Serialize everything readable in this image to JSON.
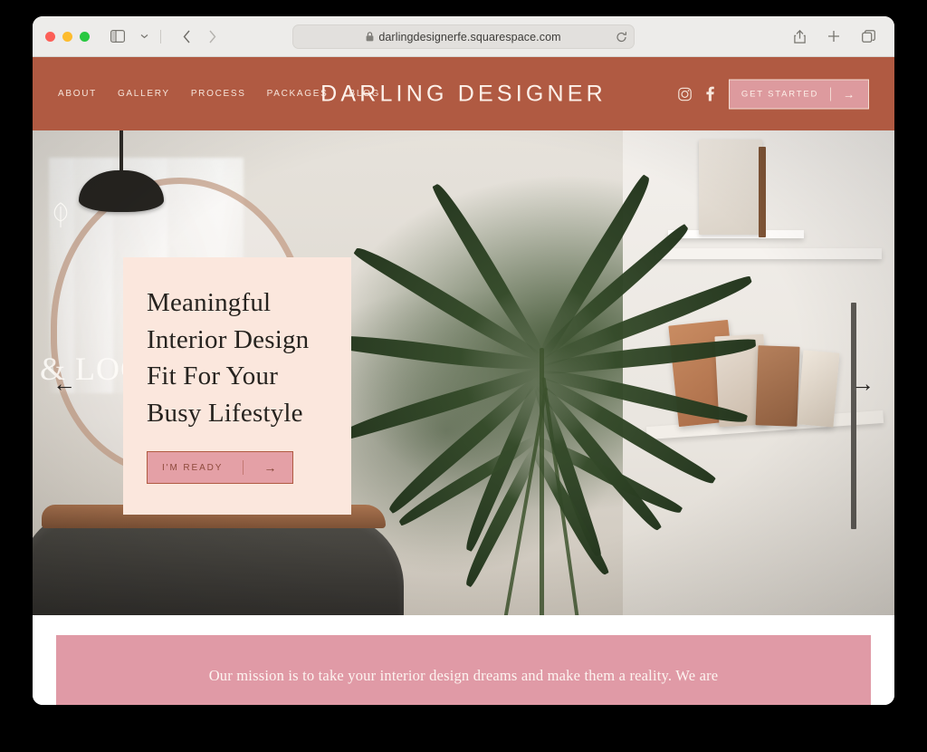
{
  "browser": {
    "url": "darlingdesignerfe.squarespace.com",
    "lock_icon": "lock-icon",
    "reload_icon": "reload-icon",
    "sidebar_icon": "sidebar-toggle-icon",
    "sidebar_chevron_icon": "chevron-down-icon",
    "back_icon": "back-chevron-icon",
    "forward_icon": "forward-chevron-icon",
    "share_icon": "share-icon",
    "new_tab_icon": "plus-icon",
    "tabs_icon": "tab-overview-icon",
    "traffic_lights": [
      "close",
      "minimize",
      "maximize"
    ]
  },
  "site": {
    "brand": "DARLING DESIGNER",
    "nav": [
      {
        "label": "ABOUT"
      },
      {
        "label": "GALLERY"
      },
      {
        "label": "PROCESS"
      },
      {
        "label": "PACKAGES"
      },
      {
        "label": "BLOG"
      }
    ],
    "social": [
      {
        "name": "instagram-icon"
      },
      {
        "name": "facebook-icon"
      }
    ],
    "header_cta": {
      "label": "GET STARTED",
      "arrow": "→"
    }
  },
  "hero": {
    "title": "Meaningful Interior Design Fit For Your Busy Lifestyle",
    "title_lines": [
      "Meaningful",
      "Interior Design",
      "Fit For Your",
      "Busy Lifestyle"
    ],
    "cta": {
      "label": "I'M READY",
      "arrow": "→"
    },
    "slider_prev": "←",
    "slider_next": "→",
    "photo_overlay_script": "& LOCA",
    "photo_doodle": "leaf-doodle-icon"
  },
  "mission": {
    "text": "Our mission is to take your interior design dreams and make them a reality. We are"
  },
  "colors": {
    "header_rust": "#b05a42",
    "card_blush": "#fbe7dd",
    "band_pink": "#e09aa6",
    "button_pink": "#e4a0a6",
    "header_button_pink": "#dd9a9e",
    "text_dark": "#26231f"
  }
}
